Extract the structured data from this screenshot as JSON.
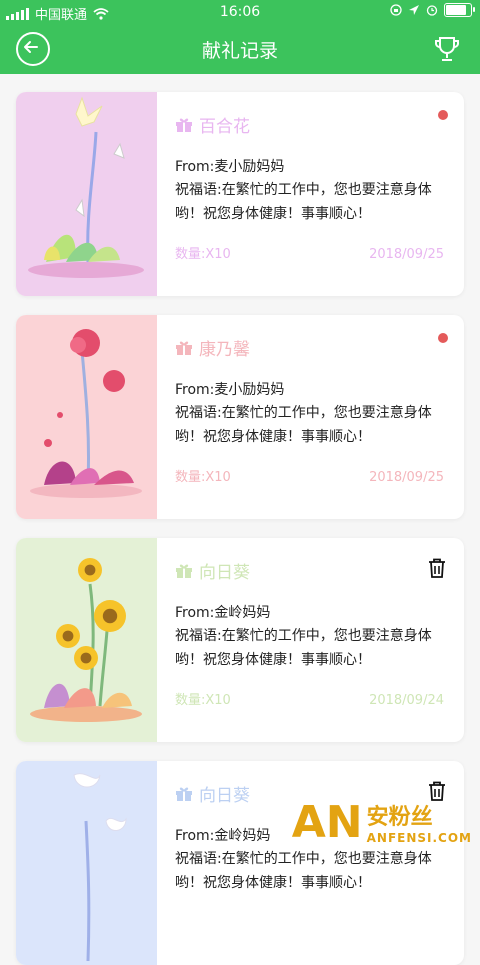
{
  "status_bar": {
    "carrier": "中国联通",
    "time": "16:06",
    "battery_level": 0.9
  },
  "header": {
    "title": "献礼记录",
    "back_icon": "back-arrow-circle-icon",
    "trophy_icon": "trophy-icon"
  },
  "records": [
    {
      "flower": "百合花",
      "from": "From:麦小励妈妈",
      "wish": "祝福语:在繁忙的工作中，您也要注意身体哟！祝您身体健康！事事顺心！",
      "quantity": "数量:X10",
      "date": "2018/09/25",
      "unread": true,
      "deletable": false,
      "accent": "#e8b6f0",
      "art_bg": "#f0cfee"
    },
    {
      "flower": "康乃馨",
      "from": "From:麦小励妈妈",
      "wish": "祝福语:在繁忙的工作中，您也要注意身体哟！祝您身体健康！事事顺心！",
      "quantity": "数量:X10",
      "date": "2018/09/25",
      "unread": true,
      "deletable": false,
      "accent": "#f4b6bc",
      "art_bg": "#fbd3d6"
    },
    {
      "flower": "向日葵",
      "from": "From:金岭妈妈",
      "wish": "祝福语:在繁忙的工作中，您也要注意身体哟！祝您身体健康！事事顺心！",
      "quantity": "数量:X10",
      "date": "2018/09/24",
      "unread": false,
      "deletable": true,
      "accent": "#cfe6b6",
      "art_bg": "#e4f1d6"
    },
    {
      "flower": "向日葵",
      "from": "From:金岭妈妈",
      "wish": "祝福语:在繁忙的工作中，您也要注意身体哟！祝您身体健康！事事顺心！",
      "quantity": "",
      "date": "",
      "unread": false,
      "deletable": true,
      "accent": "#bcd0f2",
      "art_bg": "#dbe5fb"
    }
  ],
  "watermark": {
    "logo": "AN",
    "cn": "安粉丝",
    "en": "ANFENSI.COM"
  }
}
